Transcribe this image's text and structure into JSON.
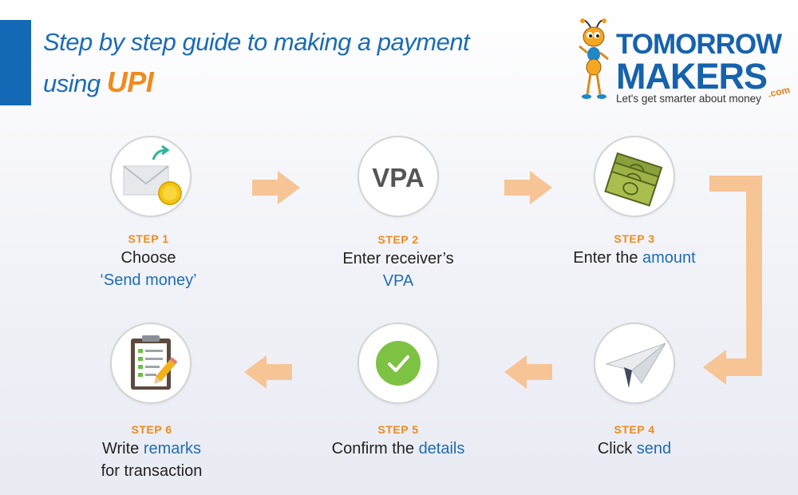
{
  "header": {
    "title_line1": "Step by step guide to making a payment",
    "title_line2_prefix": "using",
    "title_highlight": "UPI"
  },
  "logo": {
    "word1": "TOMORROW",
    "word2": "MAKERS",
    "suffix": ".com",
    "tagline": "Let's get smarter about money",
    "icon": "ant-mascot-icon"
  },
  "steps": [
    {
      "label": "STEP 1",
      "line1": "Choose",
      "line2_highlight": "‘Send money’",
      "icon": "envelope-coin-icon"
    },
    {
      "label": "STEP 2",
      "line1": "Enter receiver’s",
      "line2_highlight": "VPA",
      "icon_text": "VPA"
    },
    {
      "label": "STEP 3",
      "line1_prefix": "Enter the ",
      "line1_highlight": "amount",
      "icon": "cash-notes-icon"
    },
    {
      "label": "STEP 4",
      "line1_prefix": "Click ",
      "line1_highlight": "send",
      "icon": "paper-plane-icon"
    },
    {
      "label": "STEP 5",
      "line1_prefix": "Confirm the ",
      "line1_highlight": "details",
      "icon": "checkmark-icon"
    },
    {
      "label": "STEP 6",
      "line1_prefix": "Write ",
      "line1_highlight": "remarks",
      "line2": "for transaction",
      "icon": "clipboard-checklist-icon"
    }
  ],
  "colors": {
    "brand_blue": "#1b6cb5",
    "accent_orange": "#f08a1e",
    "arrow_peach": "#f7c495",
    "check_green": "#7dc242"
  }
}
